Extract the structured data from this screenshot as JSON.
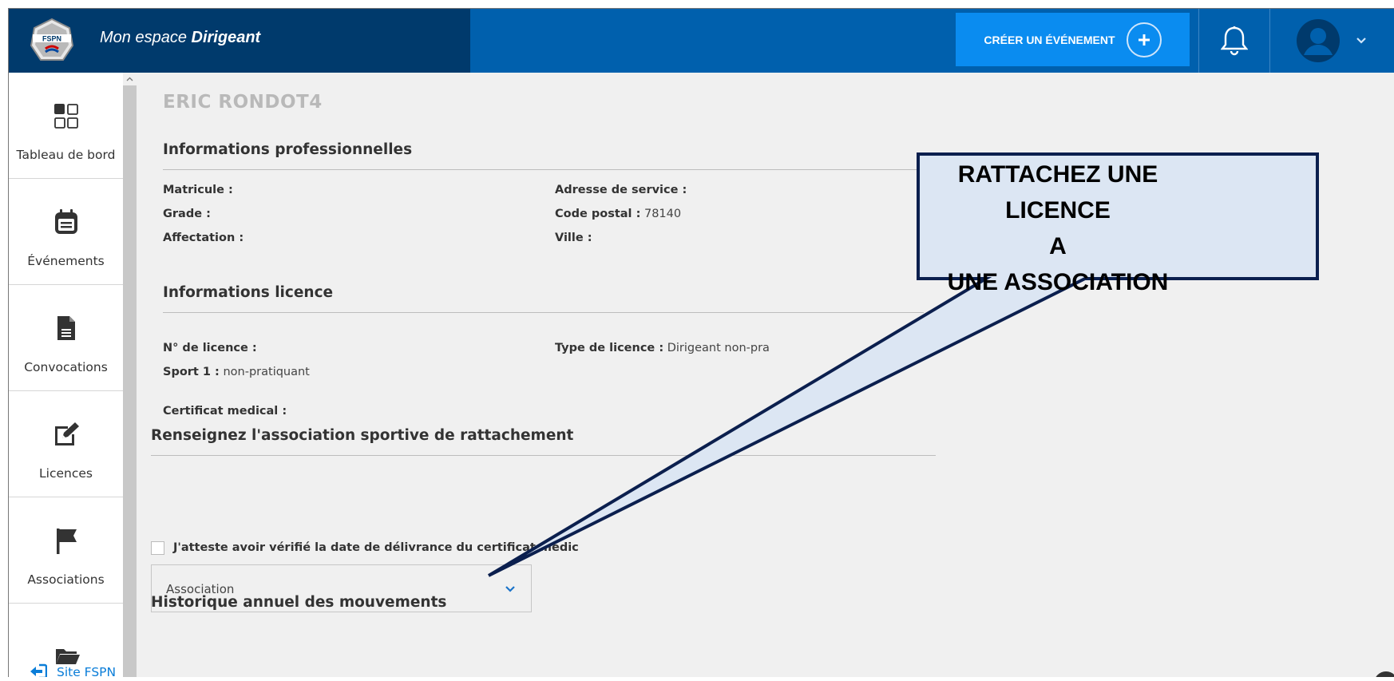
{
  "header": {
    "brand_prefix": "Mon espace ",
    "brand_emphasis": "Dirigeant",
    "logo_text": "FSPN",
    "create_button_label": "CRÉER UN ÉVÉNEMENT"
  },
  "sidebar": {
    "items": [
      {
        "label": "Tableau de bord",
        "icon": "dashboard-grid-icon"
      },
      {
        "label": "Événements",
        "icon": "calendar-icon"
      },
      {
        "label": "Convocations",
        "icon": "document-icon"
      },
      {
        "label": "Licences",
        "icon": "edit-icon"
      },
      {
        "label": "Associations",
        "icon": "flag-icon"
      }
    ],
    "site_link_label": "Site FSPN"
  },
  "profile": {
    "name": "ERIC RONDOT4",
    "pro_section_title": "Informations professionnelles",
    "matricule_label": "Matricule :",
    "matricule_value": "",
    "grade_label": "Grade :",
    "grade_value": "",
    "affectation_label": "Affectation :",
    "affectation_value": "",
    "adresse_label": "Adresse de service :",
    "adresse_value": "",
    "code_postal_label": "Code postal :",
    "code_postal_value": "78140",
    "ville_label": "Ville :",
    "ville_value": "",
    "licence_section_title": "Informations licence",
    "licence_no_label": "N° de licence :",
    "licence_no_value": "",
    "type_licence_label": "Type de licence :",
    "type_licence_value": "Dirigeant non-pra",
    "sport_label": "Sport 1 :",
    "sport_value": "non-pratiquant",
    "certificat_label": "Certificat medical :",
    "certificat_value": ""
  },
  "association": {
    "section_title": "Renseignez l'association sportive de rattachement",
    "attest_label": "J'atteste avoir vérifié la date de délivrance du certificat médic",
    "select_value": "Association"
  },
  "history": {
    "section_title": "Historique annuel des mouvements"
  },
  "callout": {
    "line1": "RATTACHEZ UNE LICENCE",
    "line2": "A",
    "line3": "UNE ASSOCIATION"
  },
  "colors": {
    "header_dark": "#003a6c",
    "header_blue": "#0060ad",
    "accent_button": "#0a8cf0",
    "callout_fill": "#dce6f3",
    "callout_border": "#0b1f4e"
  }
}
